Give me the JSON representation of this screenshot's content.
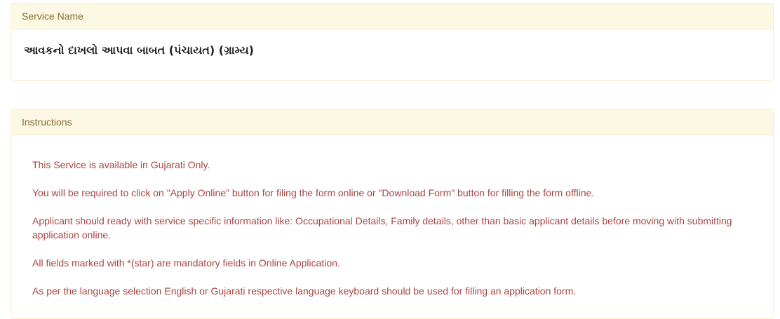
{
  "service_panel": {
    "heading": "Service Name",
    "service_name": "આવકનો દાખલો આપવા બાબત (પંચાયત) (ગ્રામ્ય)"
  },
  "instructions_panel": {
    "heading": "Instructions",
    "items": [
      "This Service is available in Gujarati Only.",
      "You will be required to click on \"Apply Online\" button for filing the form online or \"Download Form\" button for filling the form offline.",
      "Applicant should ready with service specific information like: Occupational Details, Family details, other than basic applicant details before moving with submitting application online.",
      "All fields marked with *(star) are mandatory fields in Online Application.",
      "As per the language selection English or Gujarati respective language keyboard should be used for filling an application form."
    ]
  },
  "colors": {
    "panel_border": "#faebcc",
    "panel_heading_bg": "#fcf8e3",
    "panel_heading_text": "#8a6d3b",
    "instruction_text": "#a94442"
  }
}
